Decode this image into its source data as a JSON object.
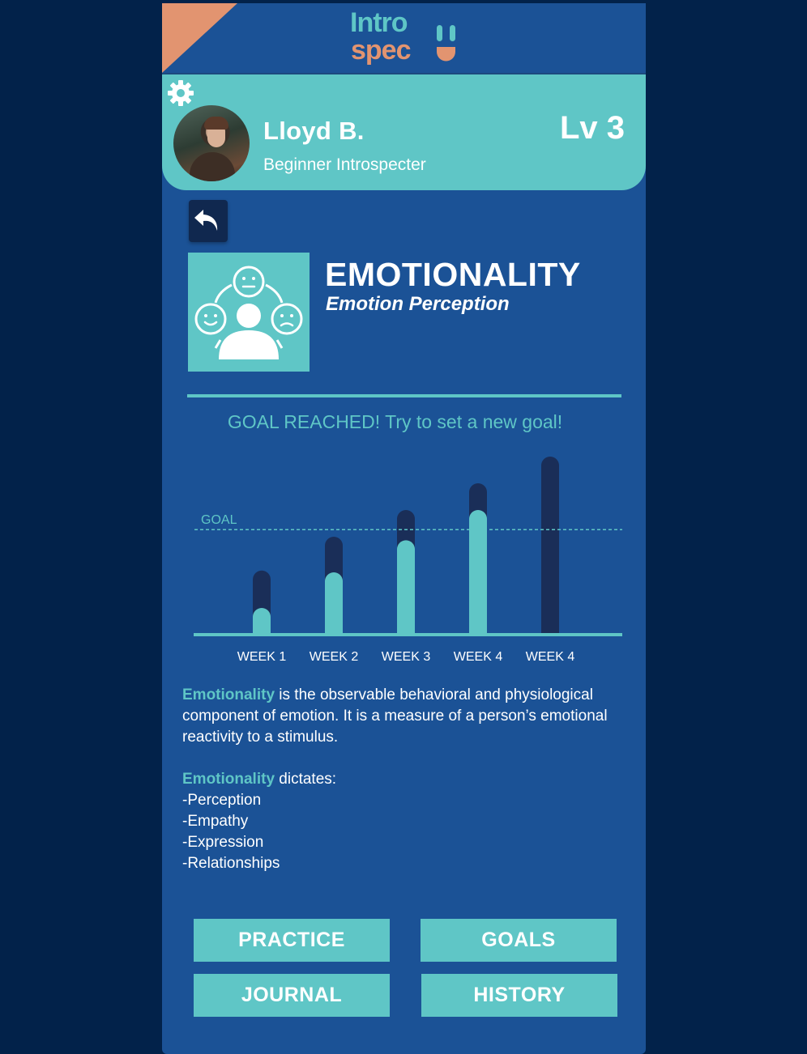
{
  "app": {
    "logo_line1": "Intro",
    "logo_line2": "spec"
  },
  "profile": {
    "name": "Lloyd B.",
    "title": "Beginner Introspecter",
    "level": "Lv 3"
  },
  "category": {
    "title": "EMOTIONALITY",
    "subtitle": "Emotion Perception"
  },
  "goal_message": "GOAL REACHED! Try to set a new goal!",
  "chart_data": {
    "type": "bar",
    "categories": [
      "WEEK 1",
      "WEEK 2",
      "WEEK 3",
      "WEEK 4",
      "WEEK 4"
    ],
    "series": [
      {
        "values": [
          0.36,
          0.55,
          0.7,
          0.85,
          1.0
        ]
      },
      {
        "values": [
          0.15,
          0.35,
          0.53,
          0.7,
          0.0
        ]
      }
    ],
    "goal_label": "GOAL",
    "goal_value": 0.59,
    "ylim": [
      0,
      1
    ],
    "colors": {
      "total": "#1a2e58",
      "progress": "#5fc6c6",
      "axis": "#5fc6c6"
    }
  },
  "description": {
    "term": "Emotionality",
    "text": " is the observable behavioral and physiological component of emotion. It is a measure of a person’s emotional reactivity to a stimulus.",
    "term2": "Emotionality",
    "dictates": " dictates:",
    "items": [
      "-Perception",
      "-Empathy",
      "-Expression",
      "-Relationships"
    ]
  },
  "buttons": {
    "practice": "PRACTICE",
    "goals": "GOALS",
    "journal": "JOURNAL",
    "history": "HISTORY"
  }
}
